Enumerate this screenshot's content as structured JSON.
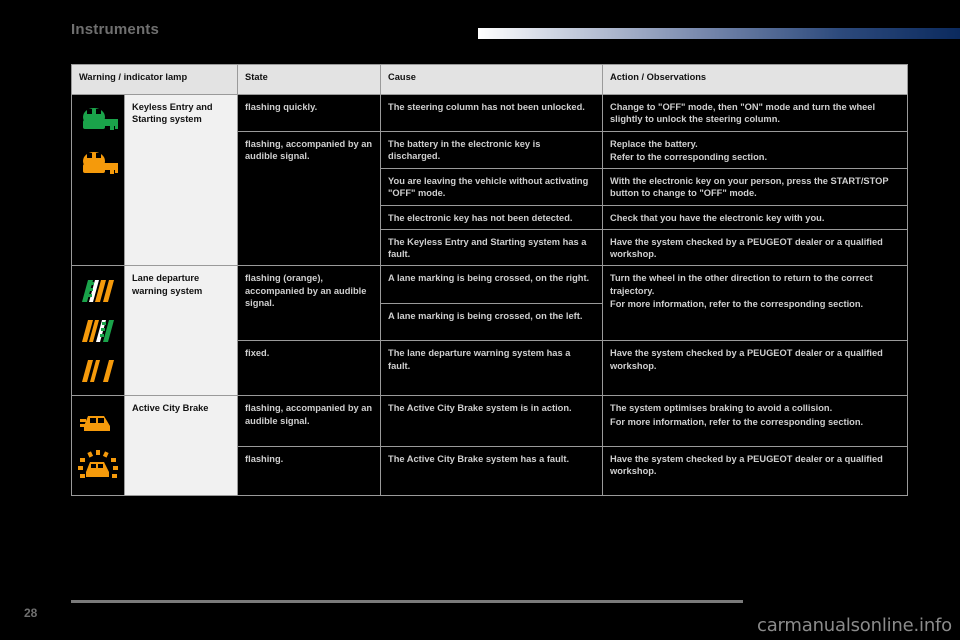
{
  "header": {
    "section_title": "Instruments",
    "accent_gradient_from": "#ffffff",
    "accent_gradient_to": "#0b2a5e"
  },
  "table": {
    "columns": [
      {
        "key": "lamp",
        "label": "Warning / indicator lamp"
      },
      {
        "key": "state",
        "label": "State"
      },
      {
        "key": "cause",
        "label": "Cause"
      },
      {
        "key": "action",
        "label": "Action / Observations"
      }
    ],
    "groups": [
      {
        "system": "Keyless Entry and Starting system",
        "icons": [
          {
            "name": "key-green-icon",
            "color": "#1aa34a"
          },
          {
            "name": "key-orange-icon",
            "color": "#f59a0b"
          }
        ],
        "rows": [
          {
            "state": "flashing quickly.",
            "cause": "The steering column has not been unlocked.",
            "action": "Change to \"OFF\" mode, then \"ON\" mode and turn the wheel slightly to unlock the steering column."
          },
          {
            "state": "flashing, accompanied by an audible signal.",
            "cause": "The battery in the electronic key is discharged.",
            "action_lines": [
              "Replace the battery.",
              "Refer to the corresponding section."
            ]
          },
          {
            "state": "",
            "cause": "You are leaving the vehicle without activating \"OFF\" mode.",
            "action": "With the electronic key on your person, press the START/STOP button to change to \"OFF\" mode."
          },
          {
            "state": "",
            "cause": "The electronic key has not been detected.",
            "action": "Check that you have the electronic key with you."
          },
          {
            "state": "",
            "cause": "The Keyless Entry and Starting system has a fault.",
            "action": "Have the system checked by a PEUGEOT dealer or a qualified workshop."
          }
        ]
      },
      {
        "system": "Lane departure warning system",
        "icons": [
          {
            "name": "lane-departure-right-icon",
            "color": "#f59a0b"
          },
          {
            "name": "lane-departure-left-icon",
            "color": "#f59a0b"
          },
          {
            "name": "lane-departure-fault-icon",
            "color": "#f59a0b"
          }
        ],
        "rows": [
          {
            "state": "flashing (orange), accompanied by an audible signal.",
            "cause": "A lane marking is being crossed, on the right.",
            "action_lines": [
              "Turn the wheel in the other direction to return to the correct trajectory.",
              "For more information, refer to the corresponding section."
            ]
          },
          {
            "state": "",
            "cause": "A lane marking is being crossed, on the left.",
            "action": ""
          },
          {
            "state": "fixed.",
            "cause": "The lane departure warning system has a fault.",
            "action": "Have the system checked by a PEUGEOT dealer or a qualified workshop."
          }
        ]
      },
      {
        "system": "Active City Brake",
        "icons": [
          {
            "name": "active-city-brake-icon",
            "color": "#f59a0b"
          },
          {
            "name": "active-city-brake-alert-icon",
            "color": "#f59a0b"
          }
        ],
        "rows": [
          {
            "state": "flashing, accompanied by an audible signal.",
            "cause": "The Active City Brake system is in action.",
            "action_lines": [
              "The system optimises braking to avoid a collision.",
              "For more information, refer to the corresponding section."
            ]
          },
          {
            "state": "flashing.",
            "cause": "The Active City Brake system has a fault.",
            "action": "Have the system checked by a PEUGEOT dealer or a qualified workshop."
          }
        ]
      }
    ]
  },
  "footer": {
    "page_number": "28",
    "watermark": "carmanualsonline.info"
  }
}
